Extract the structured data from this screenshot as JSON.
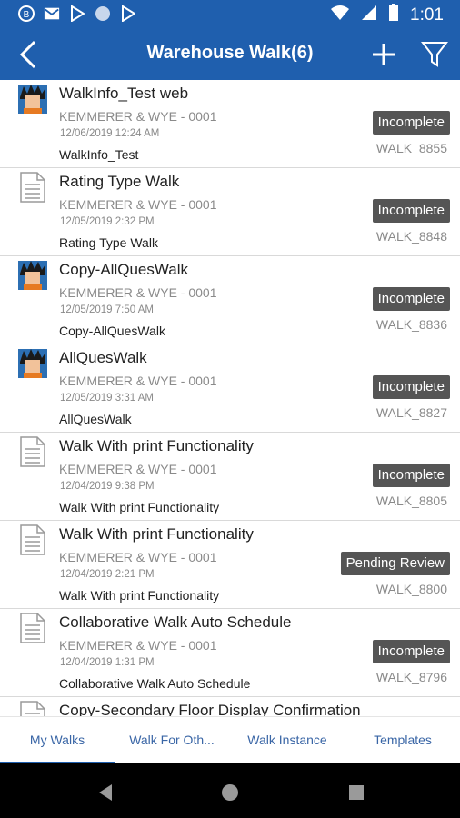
{
  "status_bar": {
    "time": "1:01",
    "left_icons": [
      "b-circle-icon",
      "mail-icon",
      "play-icon",
      "circle-icon",
      "play-icon"
    ],
    "right_icons": [
      "wifi-icon",
      "signal-icon",
      "battery-icon"
    ]
  },
  "header": {
    "title": "Warehouse Walk(6)",
    "color": "#1f5fae",
    "icons": {
      "back": "back-chevron-icon",
      "add": "plus-icon",
      "filter": "filter-funnel-icon"
    }
  },
  "walks": [
    {
      "title": "WalkInfo_Test web",
      "company": "KEMMERER & WYE - 0001",
      "datetime": "12/06/2019 12:24 AM",
      "subtitle": "WalkInfo_Test",
      "status": "Incomplete",
      "walk_id": "WALK_8855",
      "icon": "user-avatar-icon"
    },
    {
      "title": "Rating Type Walk",
      "company": "KEMMERER & WYE - 0001",
      "datetime": "12/05/2019 2:32 PM",
      "subtitle": "Rating Type Walk",
      "status": "Incomplete",
      "walk_id": "WALK_8848",
      "icon": "document-icon"
    },
    {
      "title": "Copy-AllQuesWalk",
      "company": "KEMMERER & WYE - 0001",
      "datetime": "12/05/2019 7:50 AM",
      "subtitle": "Copy-AllQuesWalk",
      "status": "Incomplete",
      "walk_id": "WALK_8836",
      "icon": "user-avatar-icon"
    },
    {
      "title": "AllQuesWalk",
      "company": "KEMMERER & WYE - 0001",
      "datetime": "12/05/2019 3:31 AM",
      "subtitle": "AllQuesWalk",
      "status": "Incomplete",
      "walk_id": "WALK_8827",
      "icon": "user-avatar-icon"
    },
    {
      "title": "Walk With print Functionality",
      "company": "KEMMERER & WYE - 0001",
      "datetime": "12/04/2019 9:38 PM",
      "subtitle": "Walk With print Functionality",
      "status": "Incomplete",
      "walk_id": "WALK_8805",
      "icon": "document-icon"
    },
    {
      "title": "Walk With print Functionality",
      "company": "KEMMERER & WYE - 0001",
      "datetime": "12/04/2019 2:21 PM",
      "subtitle": "Walk With print Functionality",
      "status": "Pending Review",
      "walk_id": "WALK_8800",
      "icon": "document-icon"
    },
    {
      "title": "Collaborative Walk Auto Schedule",
      "company": "KEMMERER & WYE - 0001",
      "datetime": "12/04/2019 1:31 PM",
      "subtitle": "Collaborative Walk Auto Schedule",
      "status": "Incomplete",
      "walk_id": "WALK_8796",
      "icon": "document-icon"
    },
    {
      "title": "Copy-Secondary Floor Display Confirmation",
      "company": "",
      "datetime": "",
      "subtitle": "",
      "status": "",
      "walk_id": "",
      "icon": "document-icon"
    }
  ],
  "tabs": [
    {
      "label": "My Walks",
      "active": true
    },
    {
      "label": "Walk For Oth...",
      "active": false
    },
    {
      "label": "Walk Instance",
      "active": false
    },
    {
      "label": "Templates",
      "active": false
    }
  ],
  "nav_icons": [
    "back-triangle-icon",
    "home-circle-icon",
    "recents-square-icon"
  ],
  "colors": {
    "badge": "#555555",
    "tab_text": "#3a66a6",
    "accent": "#1f5fae"
  }
}
